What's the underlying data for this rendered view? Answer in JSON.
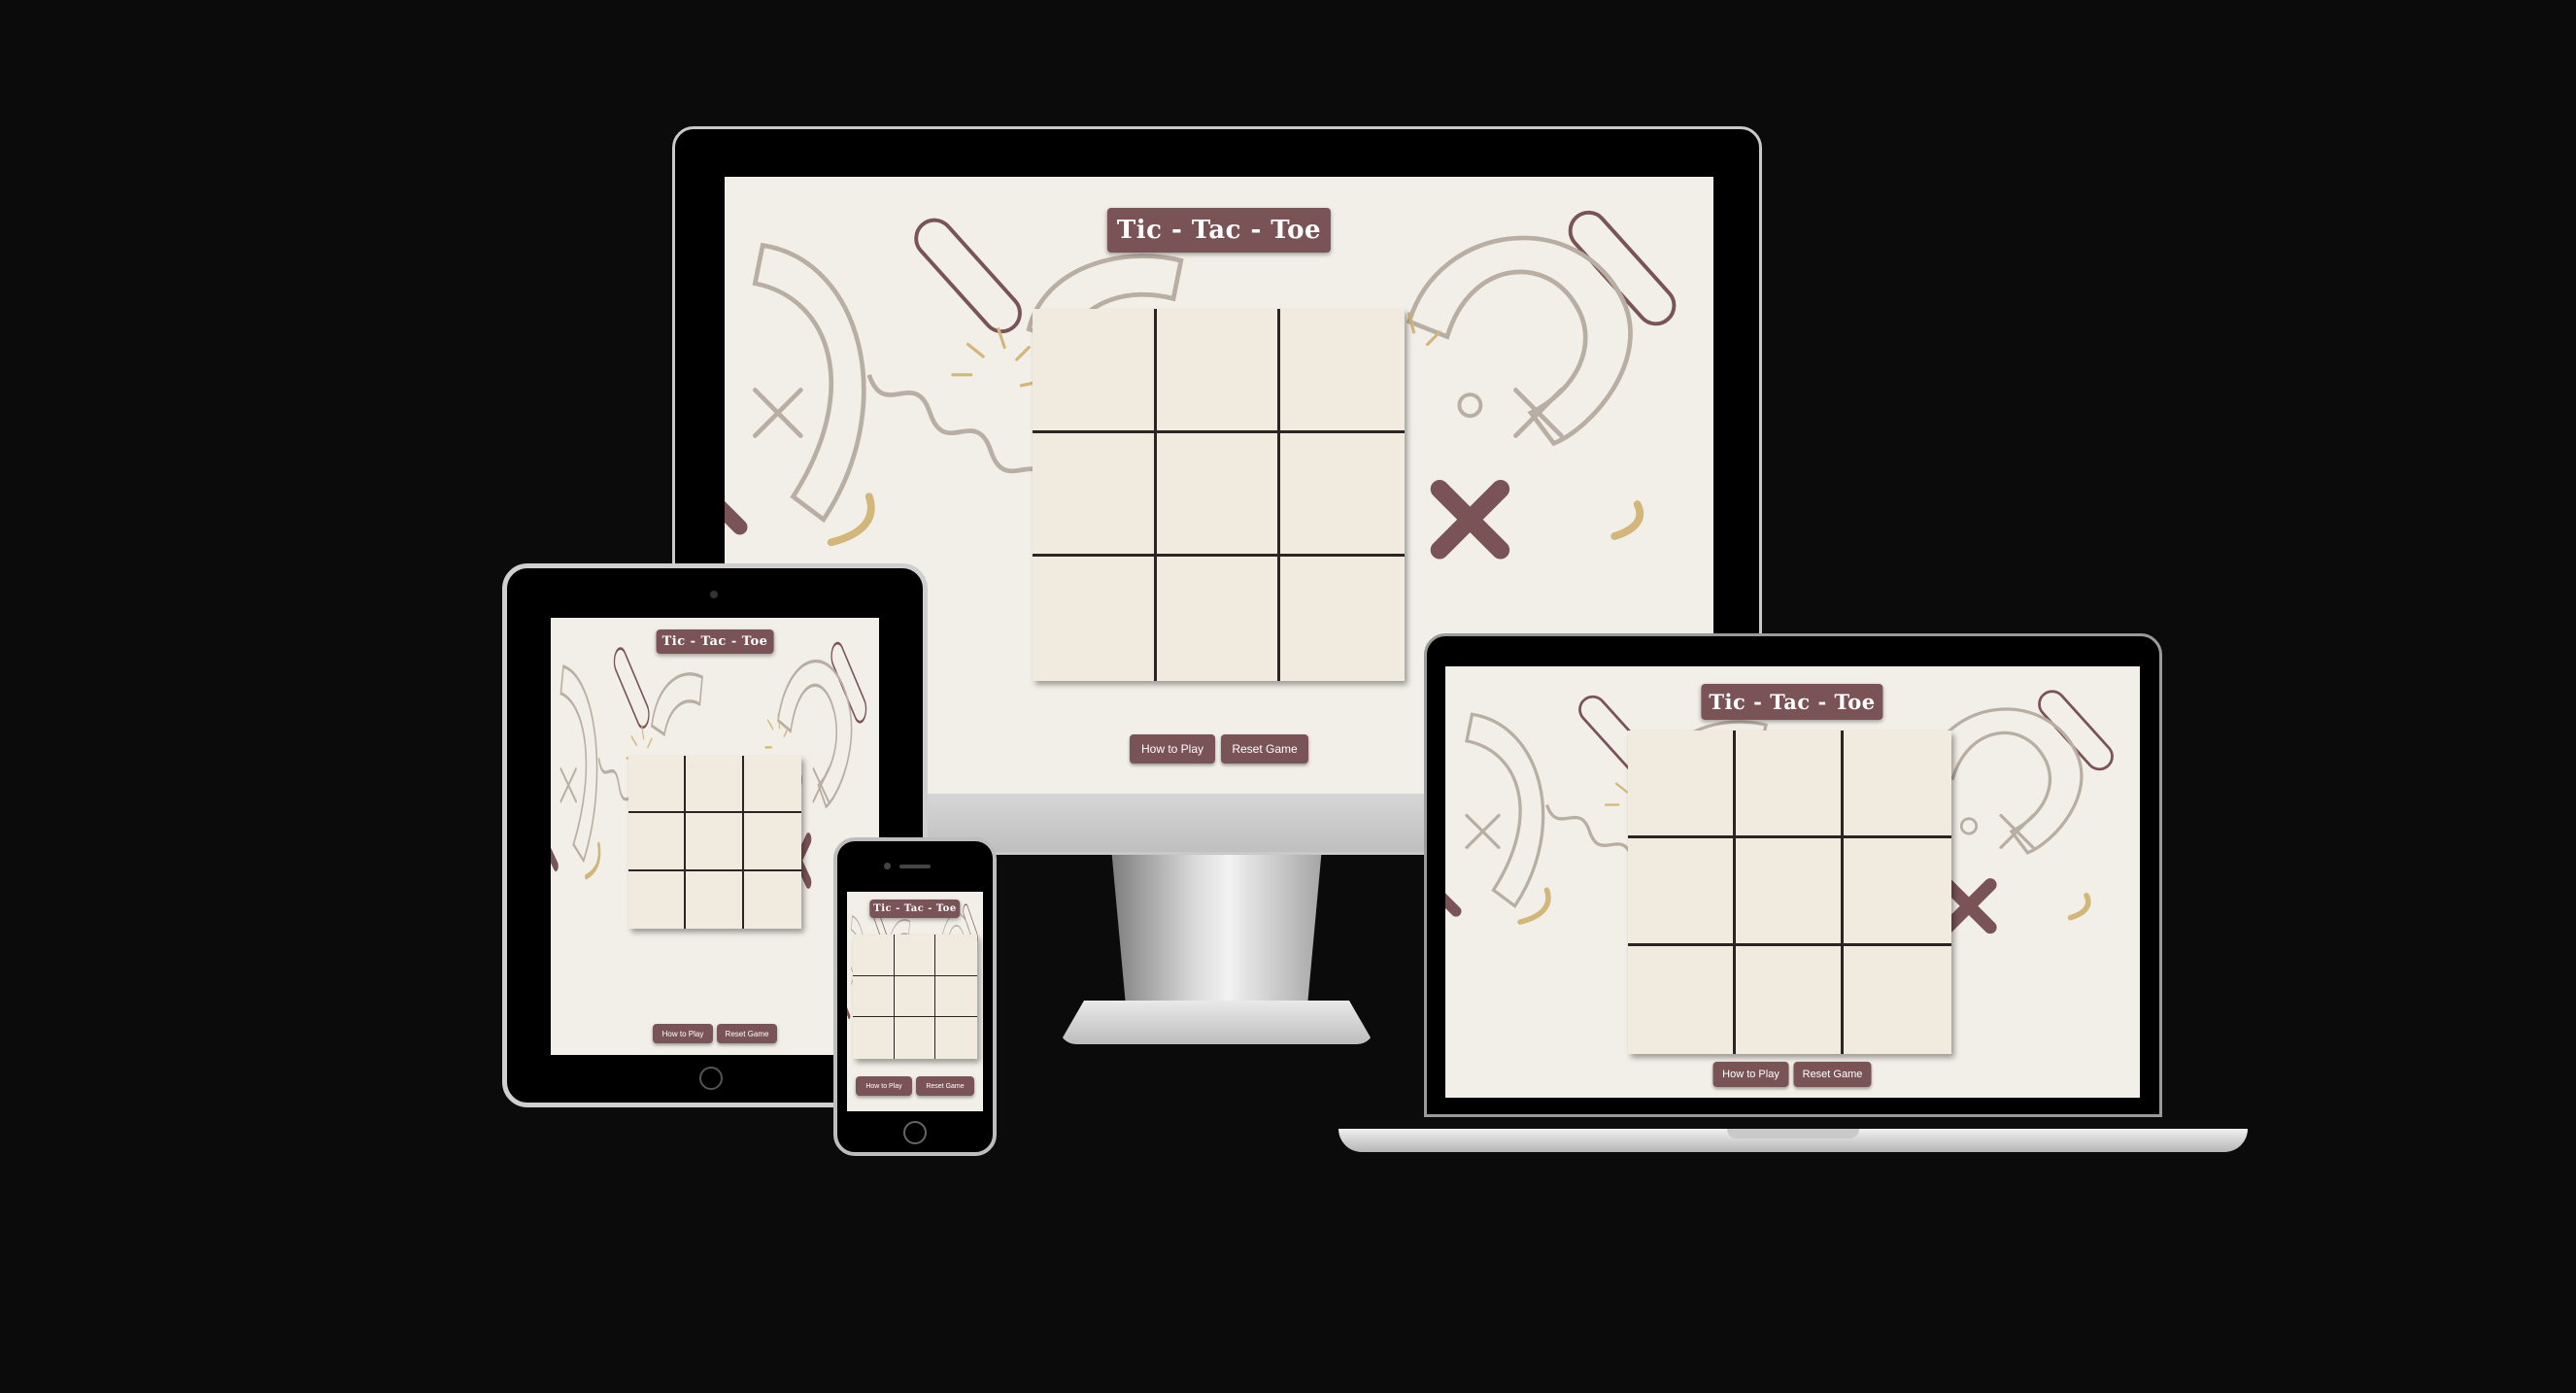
{
  "app": {
    "title": "Tic - Tac - Toe",
    "buttons": {
      "how_to_play": "How to Play",
      "reset_game": "Reset Game"
    }
  },
  "theme": {
    "background": "#0c0b0b",
    "screen_bg": "#f1efe7",
    "accent": "#7a5357",
    "board_bg": "#f1eadf",
    "grid_line": "#2b2424",
    "gold": "#d2b67a"
  },
  "devices": [
    {
      "name": "desktop-monitor"
    },
    {
      "name": "tablet"
    },
    {
      "name": "laptop"
    },
    {
      "name": "phone"
    }
  ],
  "icons": [
    "x-mark-icon",
    "pill-icon",
    "arc-icon",
    "squiggle-icon",
    "burst-icon",
    "ring-icon",
    "home-button-icon"
  ]
}
